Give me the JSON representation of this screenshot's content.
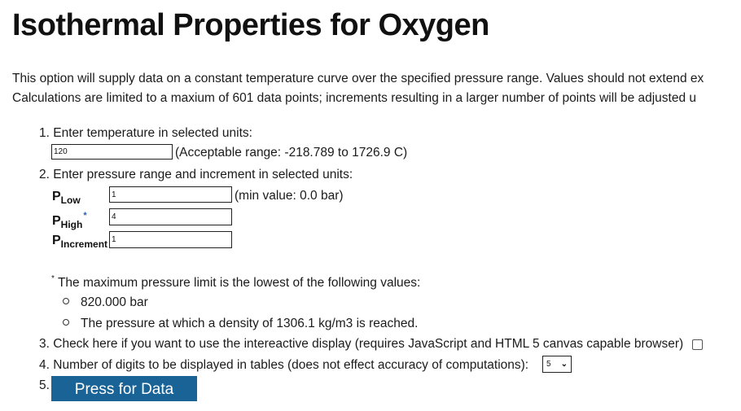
{
  "page": {
    "title": "Isothermal Properties for Oxygen",
    "intro_lines": [
      "This option will supply data on a constant temperature curve over the specified pressure range. Values should not extend ex",
      "Calculations are limited to a maxium of 601 data points; increments resulting in a larger number of points will be adjusted u"
    ]
  },
  "steps": {
    "step1": {
      "number": "1.",
      "label": "Enter temperature in selected units:",
      "temperature_value": "120",
      "range_hint": "(Acceptable range: -218.789 to 1726.9 C)"
    },
    "step2": {
      "number": "2.",
      "label": "Enter pressure range and increment in selected units:",
      "p_low": {
        "symbol": "P",
        "subscript": "Low",
        "value": "1",
        "hint": "(min value: 0.0 bar)"
      },
      "p_high": {
        "symbol": "P",
        "subscript": "High",
        "marker": "*",
        "value": "4"
      },
      "p_increment": {
        "symbol": "P",
        "subscript": "Increment",
        "value": "1"
      }
    },
    "footnote": {
      "marker": "*",
      "text": "The maximum pressure limit is the lowest of the following values:",
      "items": [
        "820.000 bar",
        "The pressure at which a density of 1306.1 kg/m3 is reached."
      ]
    },
    "step3": {
      "number": "3.",
      "label": "Check here if you want to use the intereactive display (requires JavaScript and HTML 5 canvas capable browser)",
      "checked": false
    },
    "step4": {
      "number": "4.",
      "label": "Number of digits to be displayed in tables (does not effect accuracy of computations):",
      "selected_digits": "5"
    },
    "step5": {
      "number": "5.",
      "button_label": "Press for Data"
    }
  },
  "colors": {
    "button_bg": "#1a6397",
    "button_text": "#ffffff",
    "footnote_marker": "#2a5fa8"
  }
}
